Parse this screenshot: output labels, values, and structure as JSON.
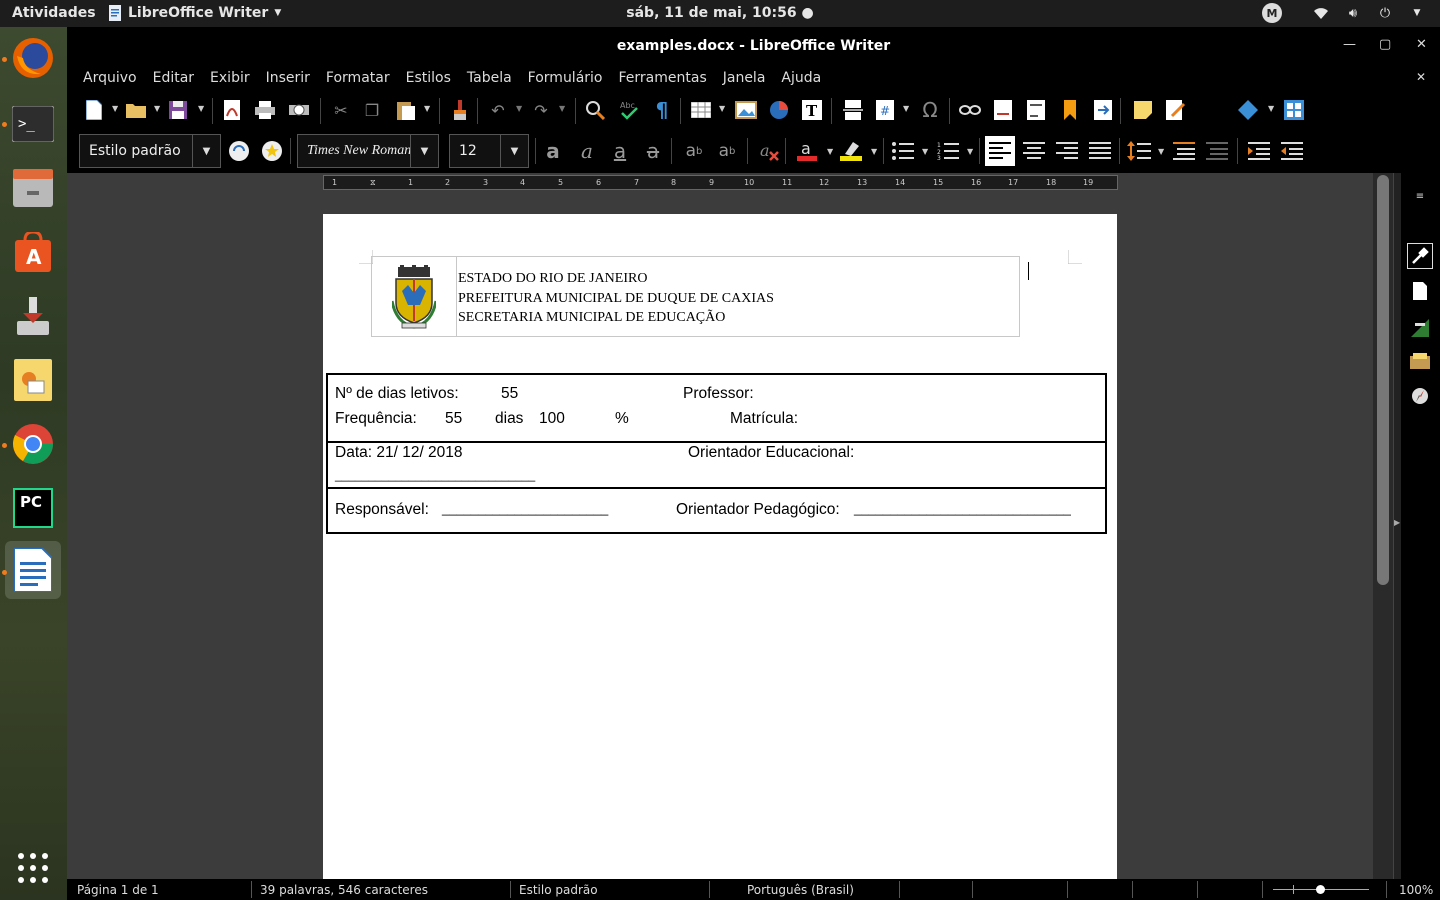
{
  "topbar": {
    "activities": "Atividades",
    "app_name": "LibreOffice Writer",
    "clock": "sáb, 11 de mai, 10:56",
    "user_badge": "M"
  },
  "dock": {
    "items": [
      "firefox-icon",
      "terminal-icon",
      "files-icon",
      "software-center-icon",
      "installer-icon",
      "image-viewer-icon",
      "chrome-icon",
      "pycharm-icon",
      "libreoffice-writer-icon",
      "app-grid-icon"
    ],
    "pycharm_label": "PC"
  },
  "window": {
    "title": "examples.docx - LibreOffice Writer"
  },
  "menubar": [
    "Arquivo",
    "Editar",
    "Exibir",
    "Inserir",
    "Formatar",
    "Estilos",
    "Tabela",
    "Formulário",
    "Ferramentas",
    "Janela",
    "Ajuda"
  ],
  "formatting": {
    "paragraph_style": "Estilo padrão",
    "font_name": "Times New Roman",
    "font_size": "12"
  },
  "ruler": {
    "numbers": [
      "1",
      "1",
      "2",
      "3",
      "4",
      "5",
      "6",
      "7",
      "8",
      "9",
      "10",
      "11",
      "12",
      "13",
      "14",
      "15",
      "16",
      "17",
      "18",
      "19"
    ]
  },
  "document": {
    "header": {
      "line1": "ESTADO DO RIO DE JANEIRO",
      "line2": "PREFEITURA MUNICIPAL DE DUQUE DE CAXIAS",
      "line3": "SECRETARIA MUNICIPAL DE EDUCAÇÃO"
    },
    "form": {
      "dias_letivos_label": "Nº de dias letivos:",
      "dias_letivos_value": "55",
      "professor_label": "Professor:",
      "frequencia_label": "Frequência:",
      "frequencia_dias": "55",
      "dias_word": "dias",
      "frequencia_pct": "100",
      "pct_symbol": "%",
      "matricula_label": "Matrícula:",
      "data_label": "Data: 21/ 12/ 2018",
      "orientador_educacional_label": "Orientador Educacional:",
      "data_underline": "______________________________",
      "responsavel_label": "Responsável:",
      "responsavel_line": "_______________________",
      "orientador_pedagogico_label": "Orientador Pedagógico:",
      "orientador_pedagogico_line": "______________________________"
    }
  },
  "statusbar": {
    "page": "Página 1 de 1",
    "words": "39 palavras, 546 caracteres",
    "style": "Estilo padrão",
    "language": "Português (Brasil)",
    "zoom": "100%"
  }
}
